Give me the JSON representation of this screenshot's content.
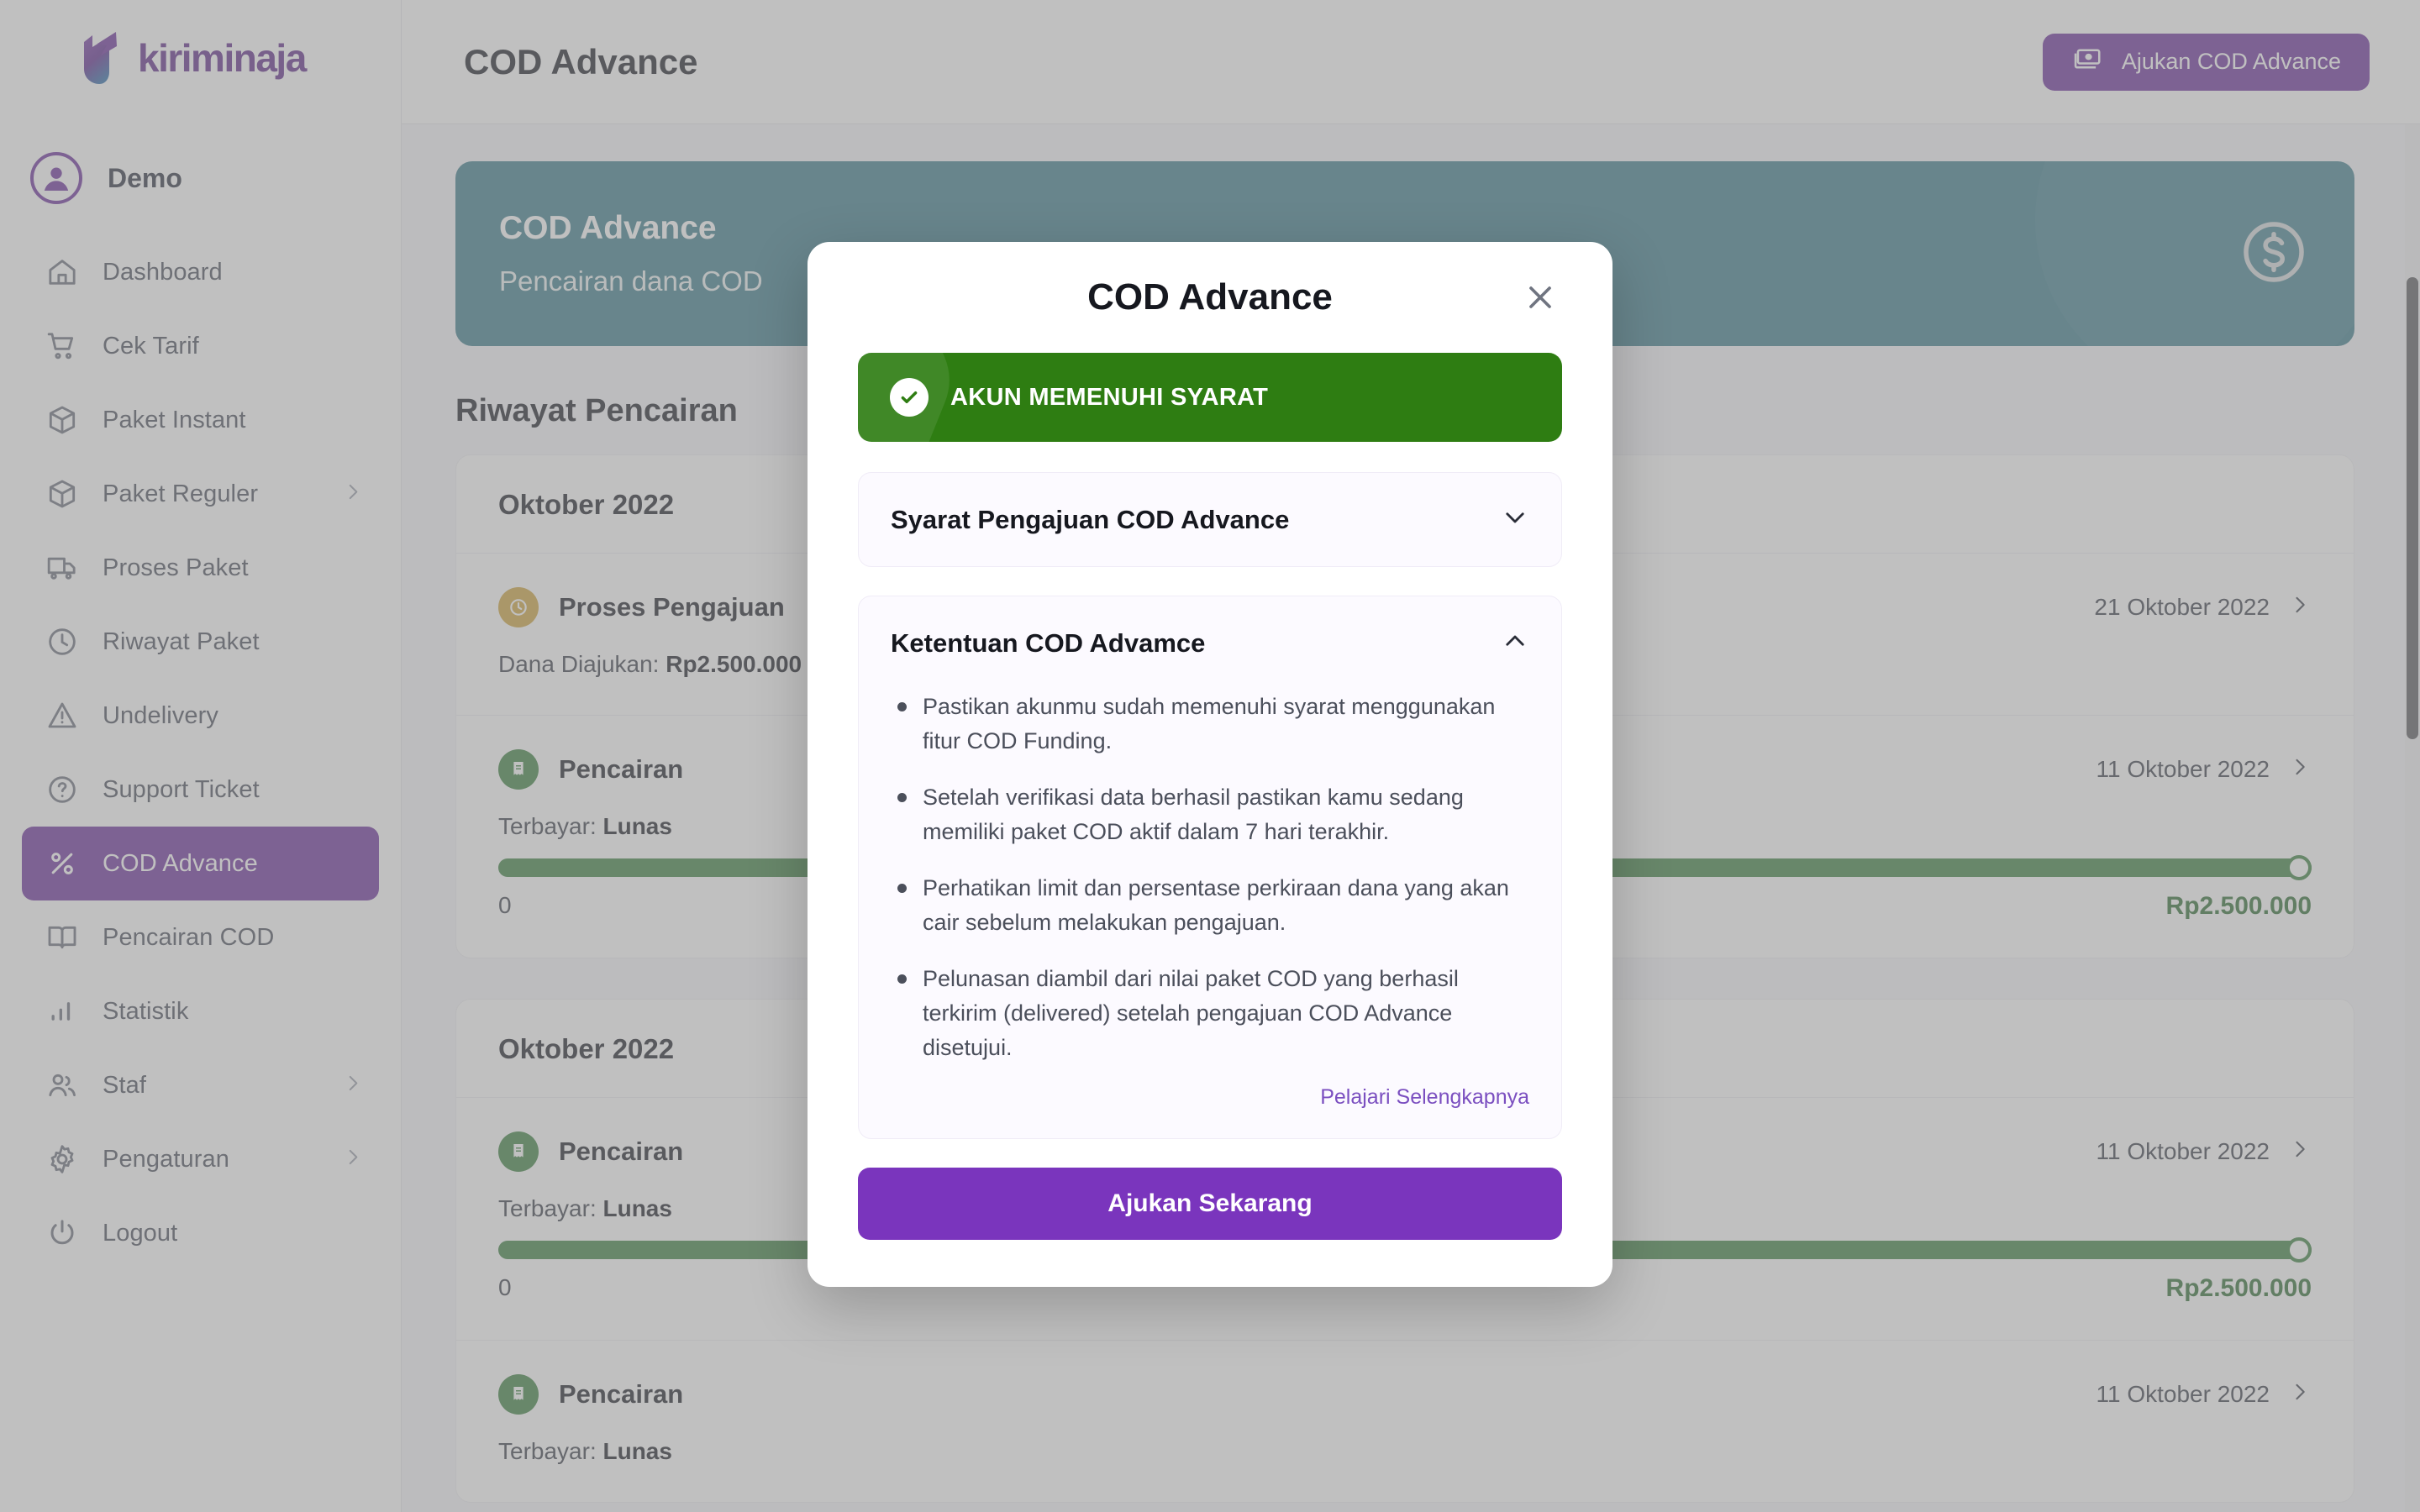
{
  "brand": {
    "name": "kiriminaja",
    "accent": "#6c2f9c"
  },
  "profile": {
    "name": "Demo"
  },
  "sidebar": {
    "items": [
      {
        "label": "Dashboard",
        "icon": "home-icon",
        "active": false,
        "expandable": false
      },
      {
        "label": "Cek Tarif",
        "icon": "cart-icon",
        "active": false,
        "expandable": false
      },
      {
        "label": "Paket Instant",
        "icon": "box-icon",
        "active": false,
        "expandable": false
      },
      {
        "label": "Paket Reguler",
        "icon": "box-icon",
        "active": false,
        "expandable": true
      },
      {
        "label": "Proses Paket",
        "icon": "truck-icon",
        "active": false,
        "expandable": false
      },
      {
        "label": "Riwayat Paket",
        "icon": "clock-icon",
        "active": false,
        "expandable": false
      },
      {
        "label": "Undelivery",
        "icon": "warning-icon",
        "active": false,
        "expandable": false
      },
      {
        "label": "Support Ticket",
        "icon": "question-icon",
        "active": false,
        "expandable": false
      },
      {
        "label": "COD Advance",
        "icon": "percent-icon",
        "active": true,
        "expandable": false
      },
      {
        "label": "Pencairan COD",
        "icon": "book-icon",
        "active": false,
        "expandable": false
      },
      {
        "label": "Statistik",
        "icon": "bar-chart-icon",
        "active": false,
        "expandable": false
      },
      {
        "label": "Staf",
        "icon": "users-icon",
        "active": false,
        "expandable": true
      },
      {
        "label": "Pengaturan",
        "icon": "gear-icon",
        "active": false,
        "expandable": true
      },
      {
        "label": "Logout",
        "icon": "power-icon",
        "active": false,
        "expandable": false
      }
    ]
  },
  "header": {
    "title": "COD Advance",
    "cta_label": "Ajukan COD Advance",
    "cta_icon": "money-icon"
  },
  "banner": {
    "title": "COD Advance",
    "subtitle": "Pencairan dana COD",
    "icon": "dollar-circle-icon",
    "color": "#3c7c8c"
  },
  "history": {
    "section_title": "Riwayat Pencairan",
    "groups": [
      {
        "month": "Oktober 2022",
        "rows": [
          {
            "status": "Proses Pengajuan",
            "status_type": "pending",
            "date": "21 Oktober 2022",
            "detail_label": "Dana Diajukan:",
            "detail_value": "Rp2.500.000",
            "has_progress": false,
            "progress_percent": 0,
            "progress_min": "",
            "progress_max": ""
          },
          {
            "status": "Pencairan",
            "status_type": "paid",
            "date": "11 Oktober 2022",
            "detail_label": "Terbayar:",
            "detail_value": "Lunas",
            "has_progress": true,
            "progress_percent": 100,
            "progress_min": "0",
            "progress_max": "Rp2.500.000"
          }
        ]
      },
      {
        "month": "Oktober 2022",
        "rows": [
          {
            "status": "Pencairan",
            "status_type": "paid",
            "date": "11 Oktober 2022",
            "detail_label": "Terbayar:",
            "detail_value": "Lunas",
            "has_progress": true,
            "progress_percent": 100,
            "progress_min": "0",
            "progress_max": "Rp2.500.000"
          },
          {
            "status": "Pencairan",
            "status_type": "paid",
            "date": "11 Oktober 2022",
            "detail_label": "Terbayar:",
            "detail_value": "Lunas",
            "has_progress": false,
            "progress_percent": 100,
            "progress_min": "",
            "progress_max": ""
          }
        ]
      }
    ]
  },
  "modal": {
    "title": "COD Advance",
    "close_icon": "close-icon",
    "eligible_badge": {
      "text": "AKUN MEMENUHI SYARAT",
      "icon": "check-circle-icon",
      "color": "#2e7d12"
    },
    "accordion_collapsed": {
      "title": "Syarat Pengajuan COD Advance",
      "icon": "chevron-down-icon"
    },
    "accordion_expanded": {
      "title": "Ketentuan COD Advamce",
      "icon": "chevron-up-icon",
      "items": [
        "Pastikan akunmu sudah memenuhi syarat menggunakan fitur COD Funding.",
        "Setelah verifikasi data berhasil pastikan kamu sedang memiliki paket COD aktif dalam 7 hari terakhir.",
        "Perhatikan limit dan persentase perkiraan dana yang akan cair sebelum melakukan pengajuan.",
        "Pelunasan diambil dari nilai paket COD yang berhasil terkirim (delivered) setelah pengajuan COD Advance disetujui."
      ],
      "link_label": "Pelajari Selengkapnya"
    },
    "submit_label": "Ajukan Sekarang"
  }
}
